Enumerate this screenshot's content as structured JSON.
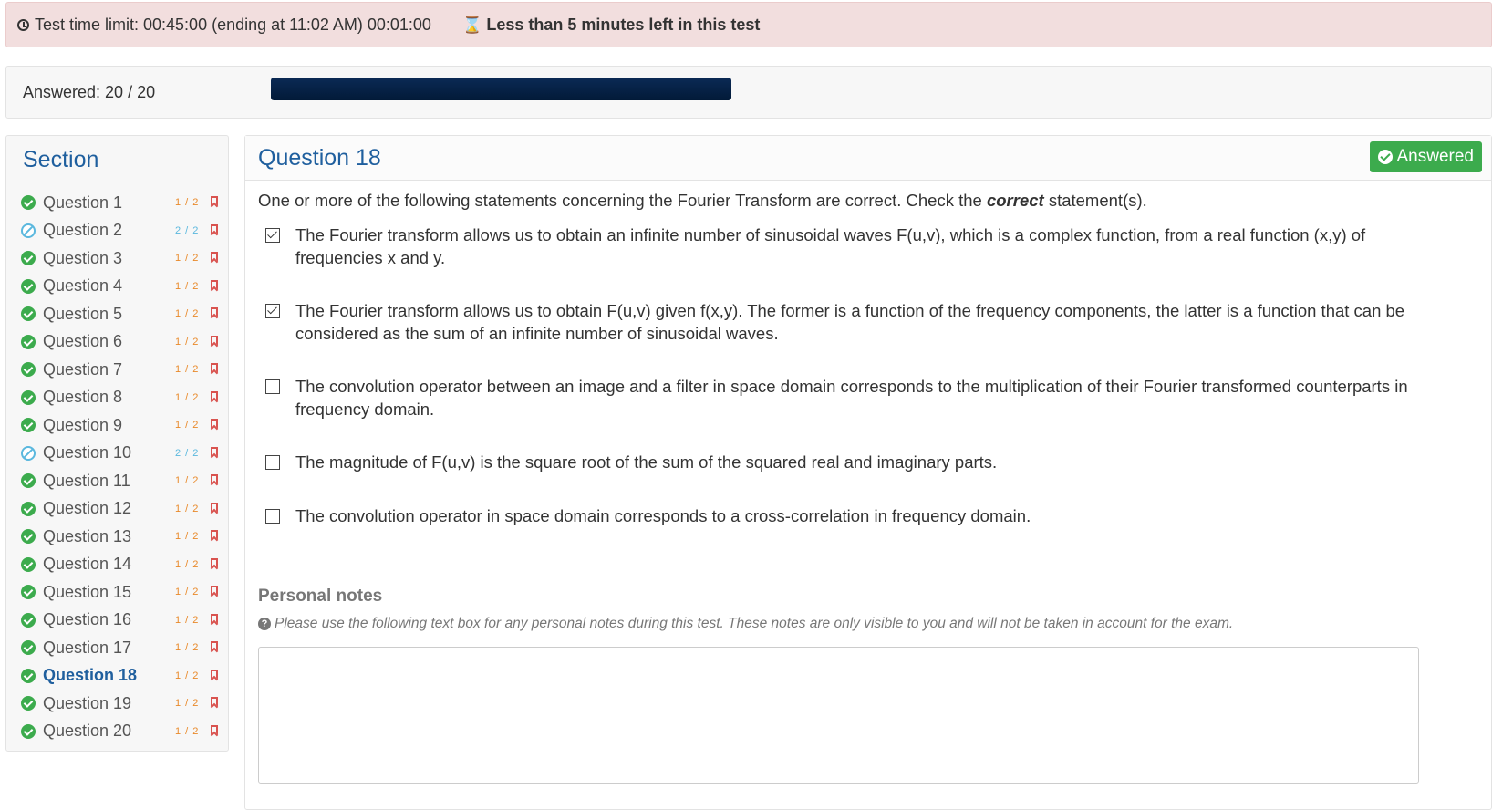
{
  "timer": {
    "text": "Test time limit: 00:45:00 (ending at 11:02 AM) 00:01:00",
    "warning": "Less than 5 minutes left in this test"
  },
  "progress": {
    "answered_label": "Answered: 20 / 20",
    "answered_fraction": 1.0
  },
  "section": {
    "title": "Section",
    "questions": [
      {
        "label": "Question 1",
        "score": "1 / 2",
        "status": "done"
      },
      {
        "label": "Question 2",
        "score": "2 / 2",
        "status": "partial"
      },
      {
        "label": "Question 3",
        "score": "1 / 2",
        "status": "done"
      },
      {
        "label": "Question 4",
        "score": "1 / 2",
        "status": "done"
      },
      {
        "label": "Question 5",
        "score": "1 / 2",
        "status": "done"
      },
      {
        "label": "Question 6",
        "score": "1 / 2",
        "status": "done"
      },
      {
        "label": "Question 7",
        "score": "1 / 2",
        "status": "done"
      },
      {
        "label": "Question 8",
        "score": "1 / 2",
        "status": "done"
      },
      {
        "label": "Question 9",
        "score": "1 / 2",
        "status": "done"
      },
      {
        "label": "Question 10",
        "score": "2 / 2",
        "status": "partial"
      },
      {
        "label": "Question 11",
        "score": "1 / 2",
        "status": "done"
      },
      {
        "label": "Question 12",
        "score": "1 / 2",
        "status": "done"
      },
      {
        "label": "Question 13",
        "score": "1 / 2",
        "status": "done"
      },
      {
        "label": "Question 14",
        "score": "1 / 2",
        "status": "done"
      },
      {
        "label": "Question 15",
        "score": "1 / 2",
        "status": "done"
      },
      {
        "label": "Question 16",
        "score": "1 / 2",
        "status": "done"
      },
      {
        "label": "Question 17",
        "score": "1 / 2",
        "status": "done"
      },
      {
        "label": "Question 18",
        "score": "1 / 2",
        "status": "done",
        "current": true
      },
      {
        "label": "Question 19",
        "score": "1 / 2",
        "status": "done"
      },
      {
        "label": "Question 20",
        "score": "1 / 2",
        "status": "done"
      }
    ]
  },
  "question": {
    "title": "Question 18",
    "badge": "Answered",
    "prompt_before": "One or more of the following statements concerning the Fourier Transform are correct. Check the ",
    "prompt_emphasis": "correct",
    "prompt_after": " statement(s).",
    "options": [
      {
        "text": "The Fourier transform allows us to obtain an infinite number of sinusoidal waves F(u,v), which is a complex function, from a real function (x,y) of frequencies x and y.",
        "checked": true
      },
      {
        "text": "The Fourier transform allows us to obtain F(u,v) given f(x,y). The former is a function of the frequency components, the latter is a function that can be considered as the sum of an infinite number of sinusoidal waves.",
        "checked": true
      },
      {
        "text": "The convolution operator between an image and a filter in space domain corresponds to the multiplication of their Fourier transformed counterparts in frequency domain.",
        "checked": false
      },
      {
        "text": "The magnitude of F(u,v) is the square root of the sum of the squared real and imaginary parts.",
        "checked": false
      },
      {
        "text": "The convolution operator in space domain corresponds to a cross-correlation in frequency domain.",
        "checked": false
      }
    ]
  },
  "notes": {
    "title": "Personal notes",
    "help": "Please use the following text box for any personal notes during this test. These notes are only visible to you and will not be taken in account for the exam.",
    "value": ""
  },
  "colors": {
    "accent": "#1f5f9e",
    "success": "#3cab4d",
    "danger_bg": "#f2dede",
    "score": "#e98a2b",
    "partial": "#5bb8de",
    "progress": "#021a38"
  }
}
